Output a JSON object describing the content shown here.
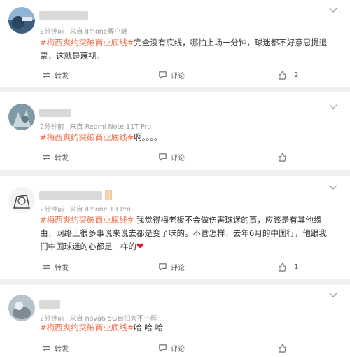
{
  "posts": [
    {
      "time": "2分钟前",
      "source": "来自 iPhone客户端",
      "topic": "#梅西爽约突破商业底线#",
      "text": "完全没有底线，哪怕上场一分钟，球迷都不好意思提退票，这就是蔑视。",
      "repost_label": "转发",
      "comment_label": "评论",
      "like_count": "2"
    },
    {
      "time": "2分钟前",
      "source": "来自 Redmi Note 11T Pro",
      "topic": "#梅西爽约突破商业底线#",
      "text": "啊。。。。",
      "repost_label": "转发",
      "comment_label": "评论",
      "like_count": ""
    },
    {
      "time": "2分钟前",
      "source": "来自 iPhone 13 Pro",
      "topic": "#梅西爽约突破商业底线#",
      "text": " 我觉得梅老板不会做伤害球迷的事，应该是有其他缘由，网络上很多事说来说去都是变了味的。不管怎样，去年6月的中国行，他跟我们中国球迷的心都是一样的",
      "emoji": "❤",
      "repost_label": "转发",
      "comment_label": "评论",
      "like_count": "1"
    },
    {
      "time": "2分钟前",
      "source": "来自 nova6 5G自拍大不一样",
      "topic": "#梅西爽约突破商业底线#",
      "text": "哈 哈 哈",
      "repost_label": "转发",
      "comment_label": "评论",
      "like_count": ""
    }
  ],
  "icons": {
    "repost": "repost-icon",
    "comment": "comment-icon",
    "like": "thumbs-up-icon",
    "menu": "chevron-down-icon"
  },
  "colors": {
    "topic": "#eb7350",
    "meta": "#9a9a9a",
    "background": "#efefef"
  }
}
